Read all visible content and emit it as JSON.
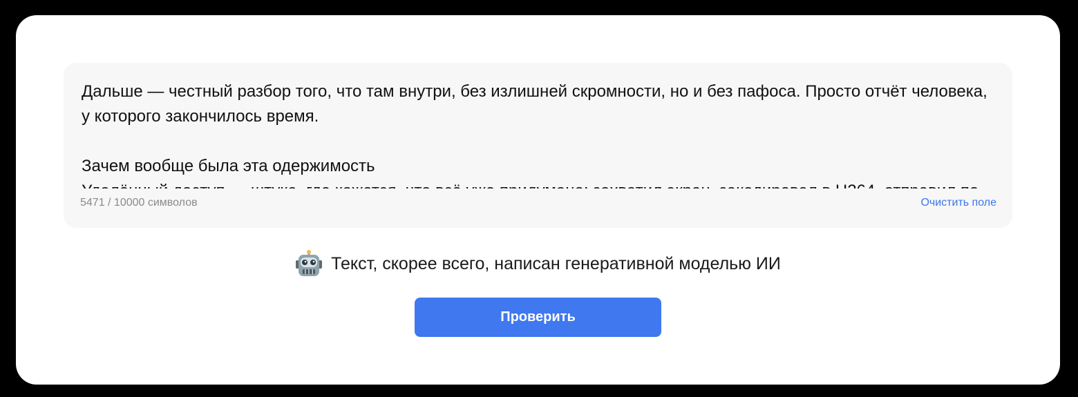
{
  "editor": {
    "text": "Дальше — честный разбор того, что там внутри, без излишней скромности, но и без пафоса. Просто отчёт человека, у которого закончилось время.\n\nЗачем вообще была эта одержимость\nУдалённый доступ — штука, где кажется, что всё уже придумано: захватил экран, закодировал в H264, отправил по сети, а дальше уже все эти ваши RustDesk, AnyDesk, TeamViewer и прочие — обычная история.",
    "char_count": "5471 / 10000 символов",
    "clear_label": "Очистить поле"
  },
  "result": {
    "icon": "robot-icon",
    "text": "Текст, скорее всего, написан генеративной моделью ИИ"
  },
  "check_button": {
    "label": "Проверить"
  },
  "colors": {
    "accent": "#3f78ef",
    "link": "#3b76ec",
    "editor_bg": "#f7f7f7",
    "counter": "#8a8a8a"
  }
}
